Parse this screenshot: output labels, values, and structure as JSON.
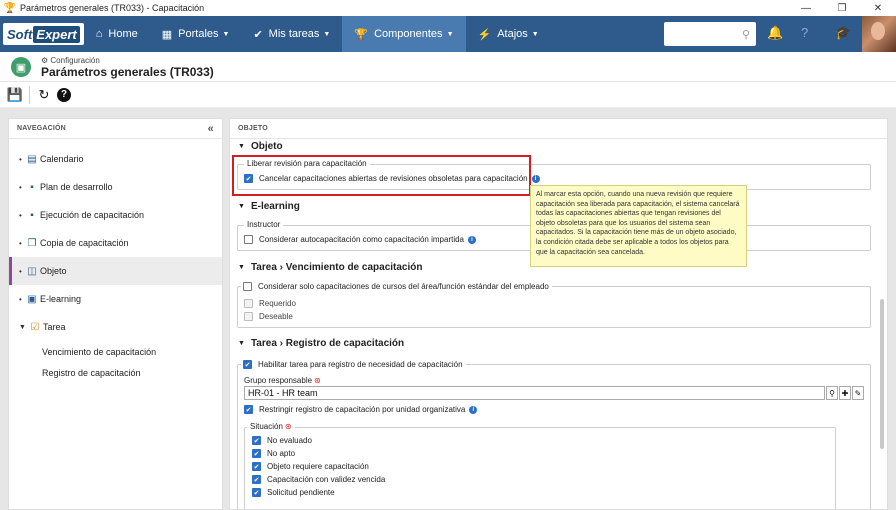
{
  "window": {
    "title": "Parámetros generales (TR033) - Capacitación",
    "minimize": "—",
    "restore": "❐",
    "close": "✕"
  },
  "navbar": {
    "logo_soft": "Soft",
    "logo_expert": "Expert",
    "items": [
      {
        "label": "Home",
        "icon": "home-icon"
      },
      {
        "label": "Portales",
        "icon": "grid-icon"
      },
      {
        "label": "Mis tareas",
        "icon": "check-icon"
      },
      {
        "label": "Componentes",
        "icon": "trophy-icon"
      },
      {
        "label": "Atajos",
        "icon": "bolt-icon"
      }
    ],
    "search_placeholder": ""
  },
  "header": {
    "breadcrumb": "Configuración",
    "title": "Parámetros generales (TR033)"
  },
  "sidebar": {
    "title": "NAVEGACIÓN",
    "items": [
      {
        "label": "Calendario",
        "icon": "calendar-icon"
      },
      {
        "label": "Plan de desarrollo",
        "icon": "plan-icon"
      },
      {
        "label": "Ejecución de capacitación",
        "icon": "execution-icon"
      },
      {
        "label": "Copia de capacitación",
        "icon": "copy-icon"
      },
      {
        "label": "Objeto",
        "icon": "object-icon"
      },
      {
        "label": "E-learning",
        "icon": "elearning-icon"
      },
      {
        "label": "Tarea",
        "icon": "task-icon"
      }
    ],
    "subitems": [
      {
        "label": "Vencimiento de capacitación"
      },
      {
        "label": "Registro de capacitación"
      }
    ]
  },
  "content": {
    "panel_title": "OBJETO",
    "objeto": {
      "title": "Objeto",
      "legend": "Liberar revisión para capacitación",
      "checkbox_label": "Cancelar capacitaciones abiertas de revisiones obsoletas para capacitación",
      "checked": true
    },
    "tooltip": "Al marcar esta opción, cuando una nueva revisión que requiere capacitación sea liberada para capacitación, el sistema cancelará todas las capacitaciones abiertas que tengan revisiones del objeto obsoletas para que los usuarios del sistema sean capacitados. Si la capacitación tiene más de un objeto asociado, la condición citada debe ser aplicable a todos los objetos para que la capacitación sea cancelada.",
    "elearning": {
      "title": "E-learning",
      "legend": "Instructor",
      "checkbox_label": "Considerar autocapacitación como capacitación impartida",
      "checked": false
    },
    "vencimiento": {
      "title": "Tarea › Vencimiento de capacitación",
      "checkbox_label": "Considerar solo capacitaciones de cursos del área/función estándar del empleado",
      "checked": false,
      "options": [
        "Requerido",
        "Deseable"
      ]
    },
    "registro": {
      "title": "Tarea › Registro de capacitación",
      "enable_label": "Habilitar tarea para registro de necesidad de capacitación",
      "group_label": "Grupo responsable",
      "group_value": "HR-01 - HR team",
      "restrict_label": "Restringir registro de capacitación por unidad organizativa",
      "situacion_legend": "Situación",
      "situaciones": [
        "No evaluado",
        "No apto",
        "Objeto requiere capacitación",
        "Capacitación con validez vencida",
        "Solicitud pendiente"
      ]
    }
  }
}
